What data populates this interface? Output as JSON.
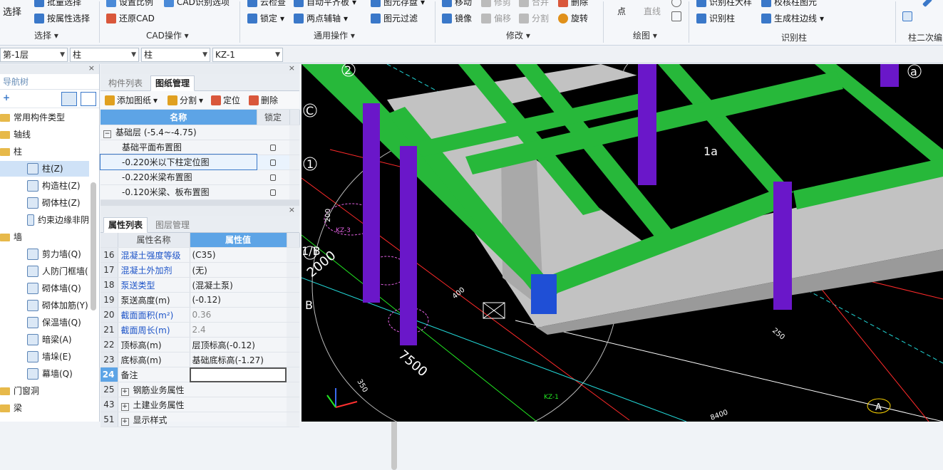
{
  "ribbon": {
    "select_big": "选择",
    "batch_select": "批量选择",
    "by_attr_select": "按属性选择",
    "select_group": "选择",
    "set_ratio": "设置比例",
    "restore_cad": "还原CAD",
    "cad_identify_opts": "CAD识别选项",
    "cad_group": "CAD操作",
    "cloud_check": "云检查",
    "lock": "锁定",
    "auto_flat": "自动平齐板",
    "two_point_aux": "两点辅轴",
    "elem_store": "图元存盘",
    "elem_filter": "图元过滤",
    "common_group": "通用操作",
    "move": "移动",
    "mirror": "镜像",
    "trim": "修剪",
    "offset": "偏移",
    "merge": "合并",
    "split": "分割",
    "delete": "删除",
    "rotate": "旋转",
    "modify_group": "修改",
    "point": "点",
    "line": "直线",
    "draw_group": "绘图",
    "ident_col_table": "识别柱大样",
    "ident_col": "识别柱",
    "check_col": "校核柱图元",
    "gen_col_edge": "生成柱边线",
    "ident_group": "识别柱",
    "col_secondary": "柱二次编"
  },
  "combos": {
    "floor": "第-1层",
    "type1": "柱",
    "type2": "柱",
    "element": "KZ-1"
  },
  "nav": {
    "title": "导航树",
    "items": [
      {
        "label": "常用构件类型",
        "kind": "folder"
      },
      {
        "label": "轴线",
        "kind": "folder"
      },
      {
        "label": "柱",
        "kind": "folder"
      },
      {
        "label": "柱(Z)",
        "kind": "child",
        "selected": true
      },
      {
        "label": "构造柱(Z)",
        "kind": "child"
      },
      {
        "label": "砌体柱(Z)",
        "kind": "child"
      },
      {
        "label": "约束边缘非阴",
        "kind": "child"
      },
      {
        "label": "墙",
        "kind": "folder"
      },
      {
        "label": "剪力墙(Q)",
        "kind": "child"
      },
      {
        "label": "人防门框墙(",
        "kind": "child"
      },
      {
        "label": "砌体墙(Q)",
        "kind": "child"
      },
      {
        "label": "砌体加筋(Y)",
        "kind": "child"
      },
      {
        "label": "保温墙(Q)",
        "kind": "child"
      },
      {
        "label": "暗梁(A)",
        "kind": "child"
      },
      {
        "label": "墙垛(E)",
        "kind": "child"
      },
      {
        "label": "幕墙(Q)",
        "kind": "child"
      },
      {
        "label": "门窗洞",
        "kind": "folder"
      },
      {
        "label": "梁",
        "kind": "folder"
      }
    ]
  },
  "drawings": {
    "tab_components": "构件列表",
    "tab_drawings": "图纸管理",
    "add_drawing": "添加图纸",
    "split": "分割",
    "locate": "定位",
    "delete": "删除",
    "col_name": "名称",
    "col_lock": "锁定",
    "rows": [
      {
        "name": "基础层 (-5.4~-4.75)",
        "group": true
      },
      {
        "name": "基础平面布置图"
      },
      {
        "name": "-0.220米以下柱定位图",
        "selected": true
      },
      {
        "name": "-0.220米梁布置图"
      },
      {
        "name": "-0.120米梁、板布置图"
      }
    ]
  },
  "props": {
    "tab_props": "属性列表",
    "tab_layers": "图层管理",
    "col_name": "属性名称",
    "col_value": "属性值",
    "rows": [
      {
        "num": "16",
        "name": "混凝土强度等级",
        "value": "(C35)",
        "blue": true
      },
      {
        "num": "17",
        "name": "混凝土外加剂",
        "value": "(无)",
        "blue": true
      },
      {
        "num": "18",
        "name": "泵送类型",
        "value": "(混凝土泵)",
        "blue": true
      },
      {
        "num": "19",
        "name": "泵送高度(m)",
        "value": "(-0.12)"
      },
      {
        "num": "20",
        "name": "截面面积(m²)",
        "value": "0.36",
        "blue": true,
        "gray": true
      },
      {
        "num": "21",
        "name": "截面周长(m)",
        "value": "2.4",
        "blue": true,
        "gray": true
      },
      {
        "num": "22",
        "name": "顶标高(m)",
        "value": "层顶标高(-0.12)"
      },
      {
        "num": "23",
        "name": "底标高(m)",
        "value": "基础底标高(-1.27)"
      },
      {
        "num": "24",
        "name": "备注",
        "value": "",
        "selected": true
      },
      {
        "num": "25",
        "name": "钢筋业务属性",
        "value": "",
        "expand": true
      },
      {
        "num": "43",
        "name": "土建业务属性",
        "value": "",
        "expand": true
      },
      {
        "num": "51",
        "name": "显示样式",
        "value": "",
        "expand": true
      }
    ]
  },
  "canvas": {
    "axis_labels": [
      "2",
      "C",
      "1",
      "1/B",
      "B",
      "1a",
      "a",
      "A"
    ],
    "dims": [
      "2000",
      "7500",
      "200",
      "400",
      "8400",
      "250",
      "350"
    ],
    "elem_labels": [
      "KZ-1",
      "KZ-3"
    ],
    "colors": {
      "beam": "#27b83a",
      "column": "#6a17c9",
      "slab": "#c8c8c8",
      "selected": "#1f4fd6"
    }
  }
}
